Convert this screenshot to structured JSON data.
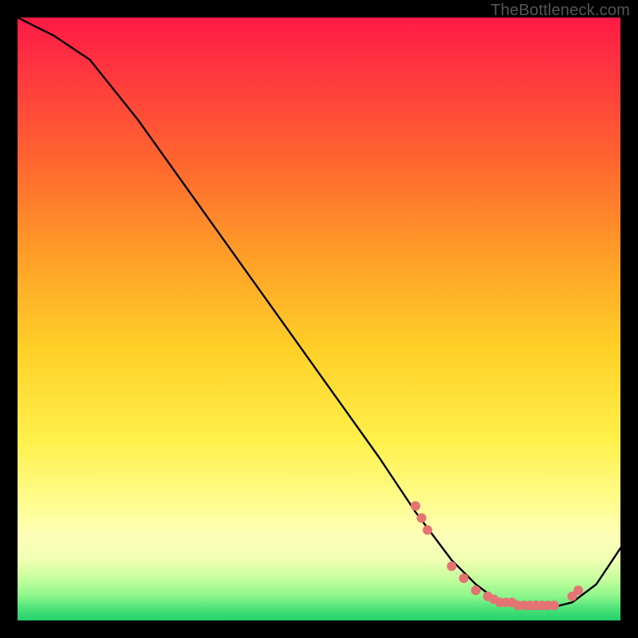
{
  "watermark": "TheBottleneck.com",
  "chart_data": {
    "type": "line",
    "title": "",
    "xlabel": "",
    "ylabel": "",
    "xlim": [
      0,
      100
    ],
    "ylim": [
      0,
      100
    ],
    "curve": {
      "name": "bottleneck-curve",
      "x": [
        0,
        6,
        12,
        20,
        30,
        40,
        50,
        60,
        66,
        72,
        76,
        80,
        84,
        88,
        92,
        96,
        100
      ],
      "y": [
        100,
        97,
        93,
        83,
        69,
        55,
        41,
        27,
        18,
        10,
        6,
        3,
        2,
        2,
        3,
        6,
        12
      ]
    },
    "points": {
      "name": "highlight-points",
      "color": "#e57373",
      "radius_px": 6,
      "x": [
        66,
        67,
        68,
        72,
        74,
        76,
        78,
        79,
        80,
        81,
        82,
        83,
        84,
        85,
        86,
        87,
        88,
        89,
        92,
        93
      ],
      "y": [
        19,
        17,
        15,
        9,
        7,
        5,
        4,
        3.5,
        3,
        3,
        3,
        2.5,
        2.5,
        2.5,
        2.5,
        2.5,
        2.5,
        2.5,
        4,
        5
      ]
    }
  }
}
